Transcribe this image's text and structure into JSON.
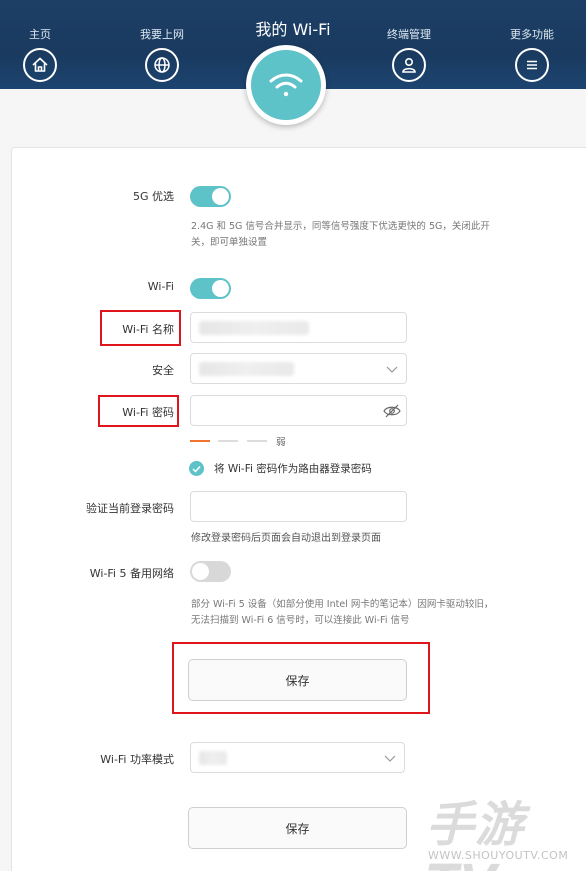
{
  "nav": {
    "items": [
      {
        "label": "主页",
        "icon": "home-icon"
      },
      {
        "label": "我要上网",
        "icon": "globe-icon"
      },
      {
        "label": "终端管理",
        "icon": "user-icon"
      },
      {
        "label": "更多功能",
        "icon": "menu-icon"
      }
    ],
    "active": {
      "label": "我的 Wi-Fi",
      "icon": "wifi-icon"
    }
  },
  "settings": {
    "pref5g": {
      "label": "5G 优选",
      "enabled": true,
      "hint_line1": "2.4G 和 5G 信号合并显示，同等信号强度下优选更快的 5G，关闭此开",
      "hint_line2": "关，即可单独设置"
    },
    "wifi": {
      "label": "Wi-Fi",
      "enabled": true
    },
    "wifi_name": {
      "label": "Wi-Fi 名称",
      "value": ""
    },
    "security": {
      "label": "安全",
      "value": ""
    },
    "wifi_password": {
      "label": "Wi-Fi 密码",
      "value": ""
    },
    "strength": {
      "text": "弱"
    },
    "use_as_login": {
      "label": "将 Wi-Fi 密码作为路由器登录密码",
      "checked": true
    },
    "verify_password": {
      "label": "验证当前登录密码",
      "value": "",
      "hint": "修改登录密码后页面会自动退出到登录页面"
    },
    "wifi5_backup": {
      "label": "Wi-Fi 5 备用网络",
      "enabled": false,
      "hint_line1": "部分 Wi-Fi 5 设备（如部分使用 Intel 网卡的笔记本）因网卡驱动较旧，",
      "hint_line2": "无法扫描到 Wi-Fi 6 信号时，可以连接此 Wi-Fi 信号"
    },
    "save_label": "保存",
    "power_mode": {
      "label": "Wi-Fi 功率模式",
      "value": ""
    },
    "save_label_2": "保存"
  },
  "watermark": {
    "main": "手游TV",
    "sub": "WWW.SHOUYOUTV.COM"
  },
  "colors": {
    "accent": "#5ec2c9",
    "header": "#1d3f66",
    "highlight": "#e0151b"
  }
}
